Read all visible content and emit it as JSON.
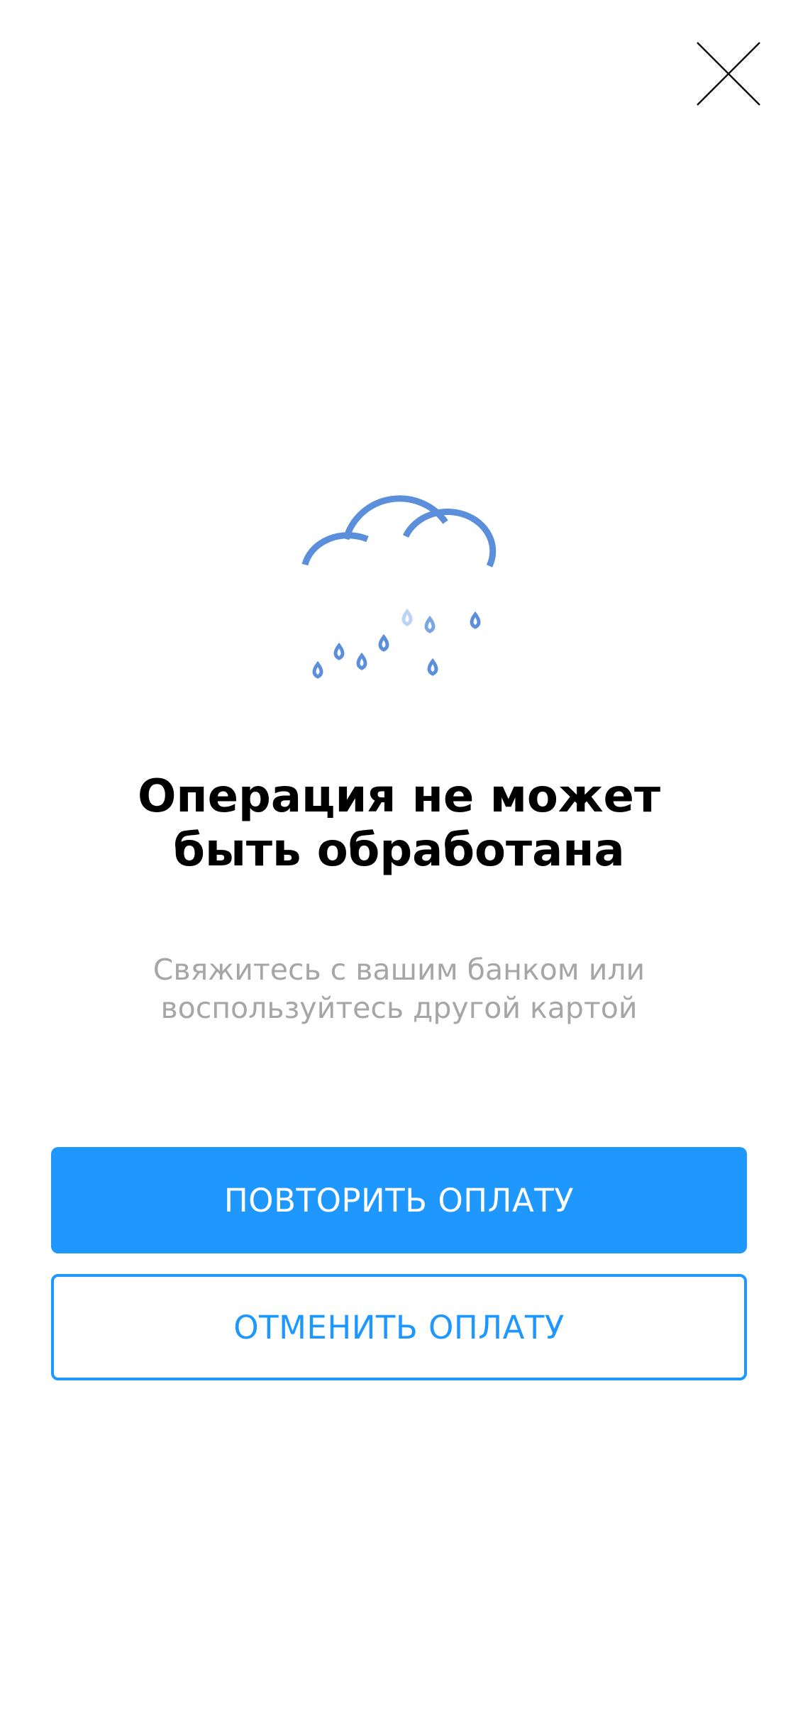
{
  "close": {
    "icon": "close-icon"
  },
  "illustration": {
    "icon": "rain-cloud-icon",
    "color": "#5b8fdc"
  },
  "message": {
    "title_line1": "Операция не может",
    "title_line2": "быть обработана",
    "subtitle_line1": "Свяжитесь с вашим банком или",
    "subtitle_line2": "воспользуйтесь другой картой"
  },
  "actions": {
    "retry_label": "ПОВТОРИТЬ ОПЛАТУ",
    "cancel_label": "ОТМЕНИТЬ ОПЛАТУ"
  },
  "colors": {
    "accent": "#1e97ff",
    "title": "#000000",
    "subtitle": "#a6a6a6"
  }
}
